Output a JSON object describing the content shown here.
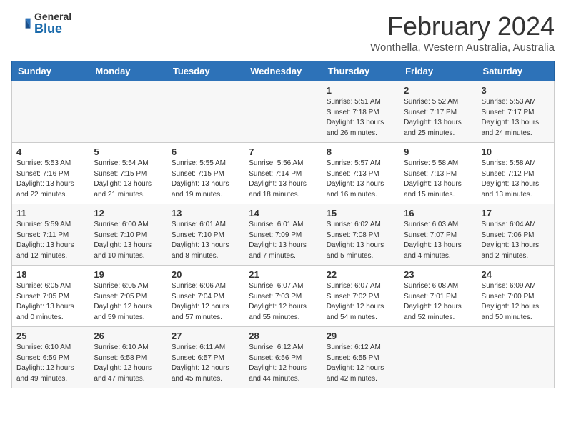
{
  "logo": {
    "general": "General",
    "blue": "Blue"
  },
  "header": {
    "month": "February 2024",
    "location": "Wonthella, Western Australia, Australia"
  },
  "days": [
    "Sunday",
    "Monday",
    "Tuesday",
    "Wednesday",
    "Thursday",
    "Friday",
    "Saturday"
  ],
  "weeks": [
    [
      {
        "day": "",
        "info": ""
      },
      {
        "day": "",
        "info": ""
      },
      {
        "day": "",
        "info": ""
      },
      {
        "day": "",
        "info": ""
      },
      {
        "day": "1",
        "info": "Sunrise: 5:51 AM\nSunset: 7:18 PM\nDaylight: 13 hours\nand 26 minutes."
      },
      {
        "day": "2",
        "info": "Sunrise: 5:52 AM\nSunset: 7:17 PM\nDaylight: 13 hours\nand 25 minutes."
      },
      {
        "day": "3",
        "info": "Sunrise: 5:53 AM\nSunset: 7:17 PM\nDaylight: 13 hours\nand 24 minutes."
      }
    ],
    [
      {
        "day": "4",
        "info": "Sunrise: 5:53 AM\nSunset: 7:16 PM\nDaylight: 13 hours\nand 22 minutes."
      },
      {
        "day": "5",
        "info": "Sunrise: 5:54 AM\nSunset: 7:15 PM\nDaylight: 13 hours\nand 21 minutes."
      },
      {
        "day": "6",
        "info": "Sunrise: 5:55 AM\nSunset: 7:15 PM\nDaylight: 13 hours\nand 19 minutes."
      },
      {
        "day": "7",
        "info": "Sunrise: 5:56 AM\nSunset: 7:14 PM\nDaylight: 13 hours\nand 18 minutes."
      },
      {
        "day": "8",
        "info": "Sunrise: 5:57 AM\nSunset: 7:13 PM\nDaylight: 13 hours\nand 16 minutes."
      },
      {
        "day": "9",
        "info": "Sunrise: 5:58 AM\nSunset: 7:13 PM\nDaylight: 13 hours\nand 15 minutes."
      },
      {
        "day": "10",
        "info": "Sunrise: 5:58 AM\nSunset: 7:12 PM\nDaylight: 13 hours\nand 13 minutes."
      }
    ],
    [
      {
        "day": "11",
        "info": "Sunrise: 5:59 AM\nSunset: 7:11 PM\nDaylight: 13 hours\nand 12 minutes."
      },
      {
        "day": "12",
        "info": "Sunrise: 6:00 AM\nSunset: 7:10 PM\nDaylight: 13 hours\nand 10 minutes."
      },
      {
        "day": "13",
        "info": "Sunrise: 6:01 AM\nSunset: 7:10 PM\nDaylight: 13 hours\nand 8 minutes."
      },
      {
        "day": "14",
        "info": "Sunrise: 6:01 AM\nSunset: 7:09 PM\nDaylight: 13 hours\nand 7 minutes."
      },
      {
        "day": "15",
        "info": "Sunrise: 6:02 AM\nSunset: 7:08 PM\nDaylight: 13 hours\nand 5 minutes."
      },
      {
        "day": "16",
        "info": "Sunrise: 6:03 AM\nSunset: 7:07 PM\nDaylight: 13 hours\nand 4 minutes."
      },
      {
        "day": "17",
        "info": "Sunrise: 6:04 AM\nSunset: 7:06 PM\nDaylight: 13 hours\nand 2 minutes."
      }
    ],
    [
      {
        "day": "18",
        "info": "Sunrise: 6:05 AM\nSunset: 7:05 PM\nDaylight: 13 hours\nand 0 minutes."
      },
      {
        "day": "19",
        "info": "Sunrise: 6:05 AM\nSunset: 7:05 PM\nDaylight: 12 hours\nand 59 minutes."
      },
      {
        "day": "20",
        "info": "Sunrise: 6:06 AM\nSunset: 7:04 PM\nDaylight: 12 hours\nand 57 minutes."
      },
      {
        "day": "21",
        "info": "Sunrise: 6:07 AM\nSunset: 7:03 PM\nDaylight: 12 hours\nand 55 minutes."
      },
      {
        "day": "22",
        "info": "Sunrise: 6:07 AM\nSunset: 7:02 PM\nDaylight: 12 hours\nand 54 minutes."
      },
      {
        "day": "23",
        "info": "Sunrise: 6:08 AM\nSunset: 7:01 PM\nDaylight: 12 hours\nand 52 minutes."
      },
      {
        "day": "24",
        "info": "Sunrise: 6:09 AM\nSunset: 7:00 PM\nDaylight: 12 hours\nand 50 minutes."
      }
    ],
    [
      {
        "day": "25",
        "info": "Sunrise: 6:10 AM\nSunset: 6:59 PM\nDaylight: 12 hours\nand 49 minutes."
      },
      {
        "day": "26",
        "info": "Sunrise: 6:10 AM\nSunset: 6:58 PM\nDaylight: 12 hours\nand 47 minutes."
      },
      {
        "day": "27",
        "info": "Sunrise: 6:11 AM\nSunset: 6:57 PM\nDaylight: 12 hours\nand 45 minutes."
      },
      {
        "day": "28",
        "info": "Sunrise: 6:12 AM\nSunset: 6:56 PM\nDaylight: 12 hours\nand 44 minutes."
      },
      {
        "day": "29",
        "info": "Sunrise: 6:12 AM\nSunset: 6:55 PM\nDaylight: 12 hours\nand 42 minutes."
      },
      {
        "day": "",
        "info": ""
      },
      {
        "day": "",
        "info": ""
      }
    ]
  ]
}
